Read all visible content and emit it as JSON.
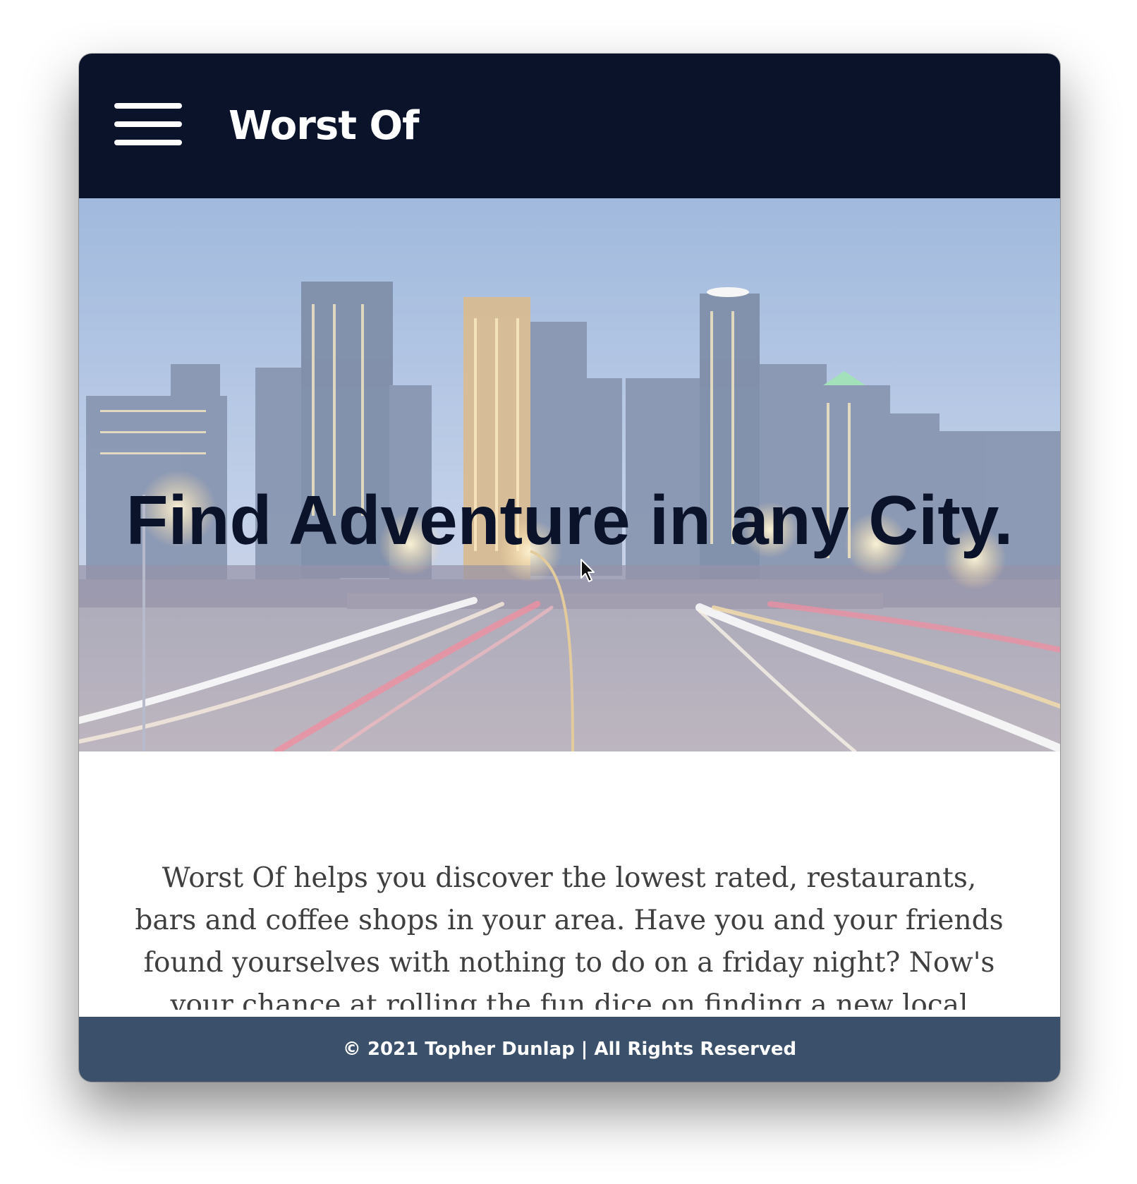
{
  "navbar": {
    "menu_icon": "hamburger-menu-icon",
    "brand": "Worst Of",
    "background_color": "#0b132b"
  },
  "hero": {
    "title": "Find Adventure in any City.",
    "image_description_icon": "city-skyline-night-image",
    "title_color": "#0b132b"
  },
  "content": {
    "description": "Worst Of helps you discover the lowest rated, restaurants, bars and coffee shops in your area. Have you and your friends found yourselves with nothing to do on a friday night? Now's your chance at rolling the fun dice on finding a new local favorite that"
  },
  "footer": {
    "text": "© 2021 Topher Dunlap | All Rights Reserved",
    "background_color": "#3a506b"
  }
}
